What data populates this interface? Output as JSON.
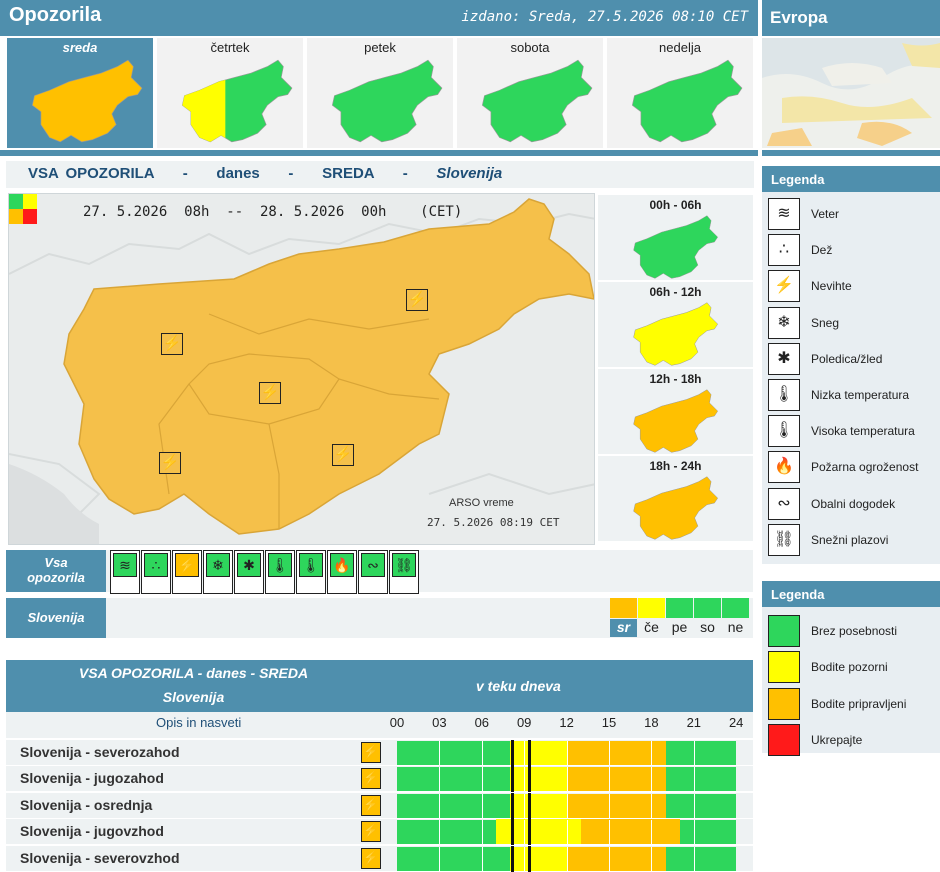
{
  "header": {
    "title": "Opozorila",
    "issued": "izdano: Sreda, 27.5.2026 08:10 CET",
    "europe": "Evropa"
  },
  "days": [
    {
      "label": "sreda",
      "selected": true
    },
    {
      "label": "četrtek",
      "selected": false
    },
    {
      "label": "petek",
      "selected": false
    },
    {
      "label": "sobota",
      "selected": false
    },
    {
      "label": "nedelja",
      "selected": false
    }
  ],
  "section": {
    "a": "VSA OPOZORILA",
    "b": "danes",
    "c": "SREDA",
    "d": "Slovenija"
  },
  "main_map": {
    "range": "27. 5.2026  08h  --  28. 5.2026  00h    (CET)",
    "credit": "ARSO vreme",
    "stamp": "27. 5.2026  08:19 CET"
  },
  "periods": [
    {
      "label": "00h - 06h",
      "color": "#2ed65c"
    },
    {
      "label": "06h - 12h",
      "color": "#ffff00"
    },
    {
      "label": "12h - 18h",
      "color": "#ffc000"
    },
    {
      "label": "18h - 24h",
      "color": "#ffc000"
    }
  ],
  "icon_row": {
    "label_line1": "Vsa",
    "label_line2": "opozorila",
    "slovenija": "Slovenija"
  },
  "mini_days": [
    "sr",
    "če",
    "pe",
    "so",
    "ne"
  ],
  "legend_types": {
    "title": "Legenda",
    "items": [
      "Veter",
      "Dež",
      "Nevihte",
      "Sneg",
      "Poledica/žled",
      "Nizka temperatura",
      "Visoka temperatura",
      "Požarna ogroženost",
      "Obalni dogodek",
      "Snežni plazovi"
    ]
  },
  "legend_levels": {
    "title": "Legenda",
    "items": [
      {
        "label": "Brez posebnosti",
        "color": "#2ed65c"
      },
      {
        "label": "Bodite pozorni",
        "color": "#ffff00"
      },
      {
        "label": "Bodite pripravljeni",
        "color": "#ffc000"
      },
      {
        "label": "Ukrepajte",
        "color": "#ff1a1a"
      }
    ]
  },
  "table": {
    "title_line1": "VSA OPOZORILA - danes - SREDA",
    "title_line2": "Slovenija",
    "during_day": "v teku dneva",
    "desc_link": "Opis in nasveti",
    "hours": [
      "00",
      "03",
      "06",
      "09",
      "12",
      "15",
      "18",
      "21",
      "24"
    ],
    "rows": [
      "Slovenija - severozahod",
      "Slovenija - jugozahod",
      "Slovenija - osrednja",
      "Slovenija - jugovzhod",
      "Slovenija - severovzhod"
    ]
  }
}
